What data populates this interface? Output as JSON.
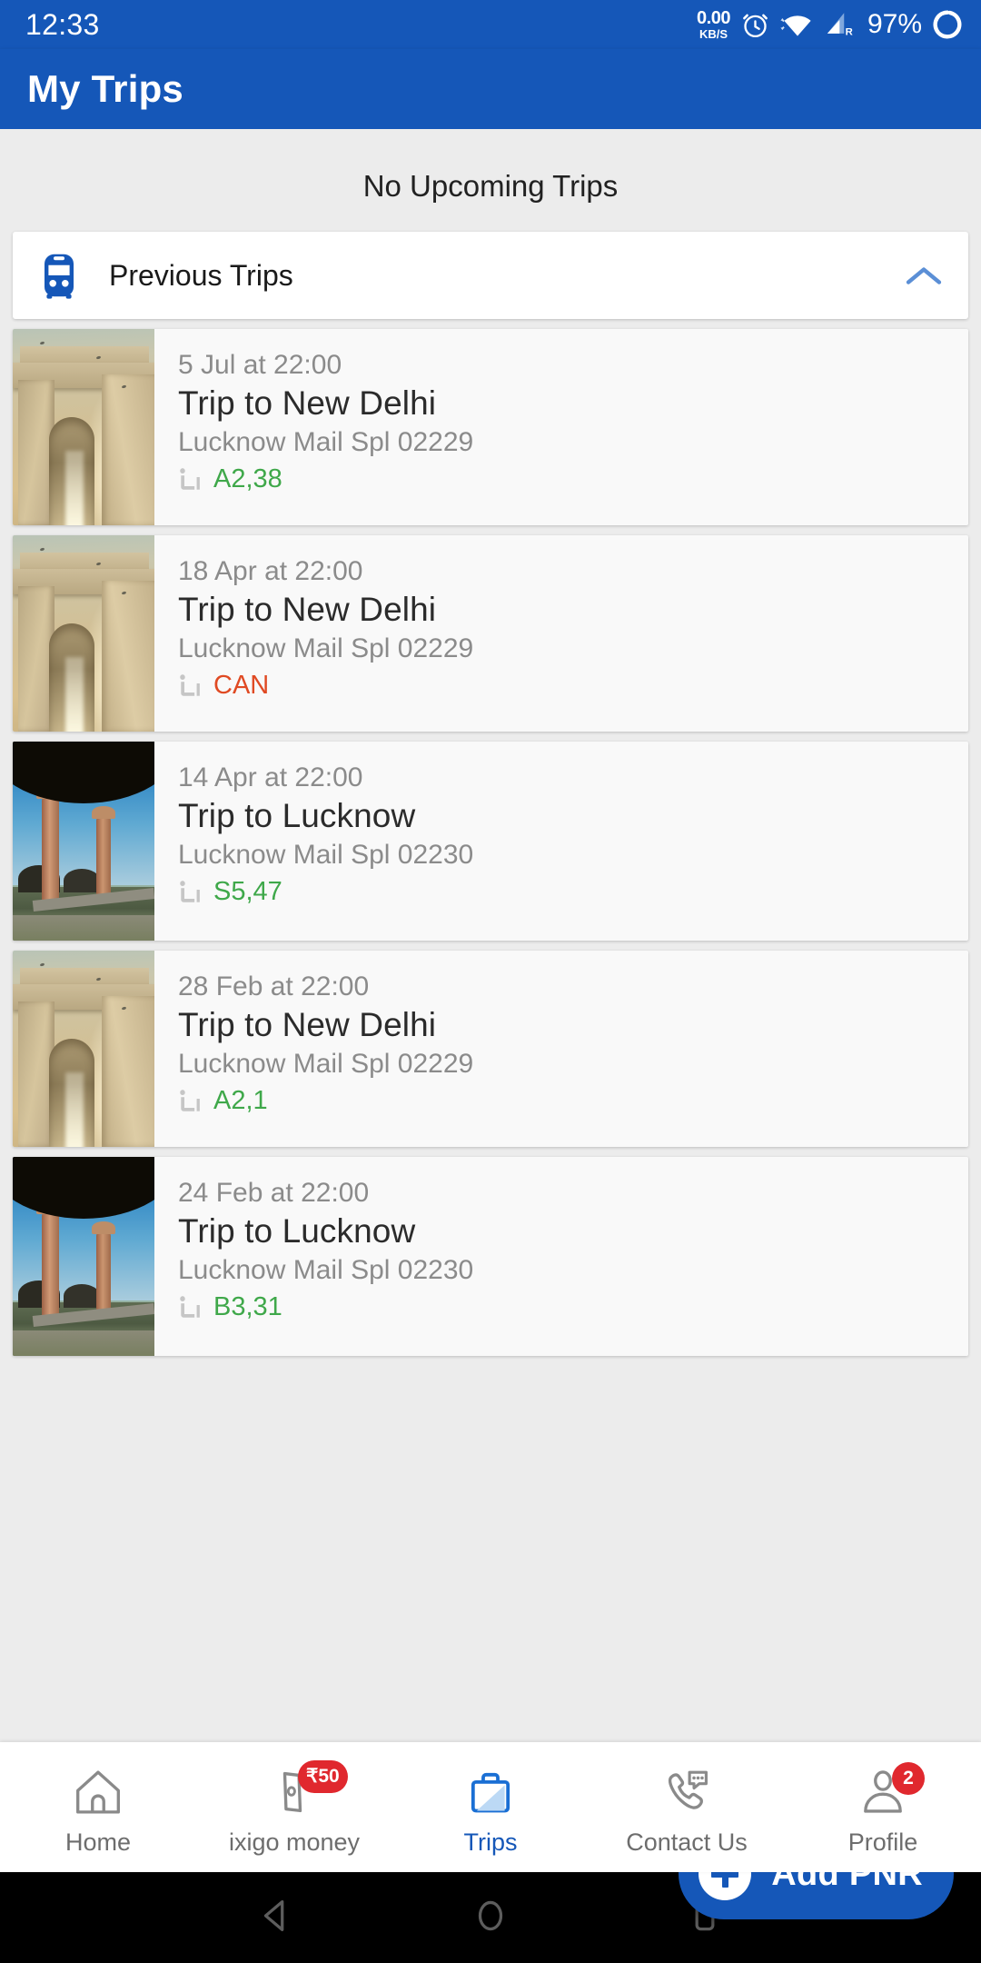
{
  "status_bar": {
    "time": "12:33",
    "net_speed_value": "0.00",
    "net_speed_unit": "KB/S",
    "alarm_icon": "alarm-clock-icon",
    "wifi_icon": "wifi-icon",
    "signal_icon": "cellular-signal-roaming-icon",
    "signal_label": "R",
    "battery_percent": "97%",
    "battery_icon": "battery-circle-icon"
  },
  "app_bar": {
    "title": "My Trips",
    "background": "#1557b8"
  },
  "main": {
    "no_upcoming_text": "No Upcoming Trips",
    "previous_trips": {
      "icon": "train-front-icon",
      "label": "Previous Trips",
      "chevron": "chevron-up-icon",
      "expanded": true
    },
    "trips": [
      {
        "date": "5 Jul at 22:00",
        "title": "Trip to New Delhi",
        "train": "Lucknow Mail Spl  02229",
        "seat": "A2,38",
        "seat_status": "confirmed",
        "seat_color": "#3fa84a",
        "thumb": "india-gate-photo"
      },
      {
        "date": "18 Apr at 22:00",
        "title": "Trip to New Delhi",
        "train": "Lucknow Mail Spl  02229",
        "seat": "CAN",
        "seat_status": "cancelled",
        "seat_color": "#e04a23",
        "thumb": "india-gate-photo"
      },
      {
        "date": "14 Apr at 22:00",
        "title": "Trip to Lucknow",
        "train": "Lucknow Mail Spl  02230",
        "seat": "S5,47",
        "seat_status": "confirmed",
        "seat_color": "#3fa84a",
        "thumb": "lucknow-imambara-photo"
      },
      {
        "date": "28 Feb at 22:00",
        "title": "Trip to New Delhi",
        "train": "Lucknow Mail Spl  02229",
        "seat": "A2,1",
        "seat_status": "confirmed",
        "seat_color": "#3fa84a",
        "thumb": "india-gate-photo"
      },
      {
        "date": "24 Feb at 22:00",
        "title": "Trip to Lucknow",
        "train": "Lucknow Mail Spl  02230",
        "seat": "B3,31",
        "seat_status": "confirmed",
        "seat_color": "#3fa84a",
        "thumb": "lucknow-imambara-photo"
      }
    ],
    "fab": {
      "label": "Add PNR",
      "icon": "plus-icon",
      "color": "#1557b8"
    }
  },
  "bottom_nav": {
    "active": "Trips",
    "items": [
      {
        "label": "Home",
        "icon": "home-icon",
        "badge": null
      },
      {
        "label": "ixigo money",
        "icon": "money-note-icon",
        "badge": "₹50"
      },
      {
        "label": "Trips",
        "icon": "briefcase-icon",
        "badge": null
      },
      {
        "label": "Contact Us",
        "icon": "phone-chat-icon",
        "badge": null
      },
      {
        "label": "Profile",
        "icon": "person-icon",
        "badge": "2"
      }
    ]
  },
  "android_nav": {
    "back": "back-triangle-icon",
    "home": "home-circle-icon",
    "recents": "recents-square-icon"
  }
}
